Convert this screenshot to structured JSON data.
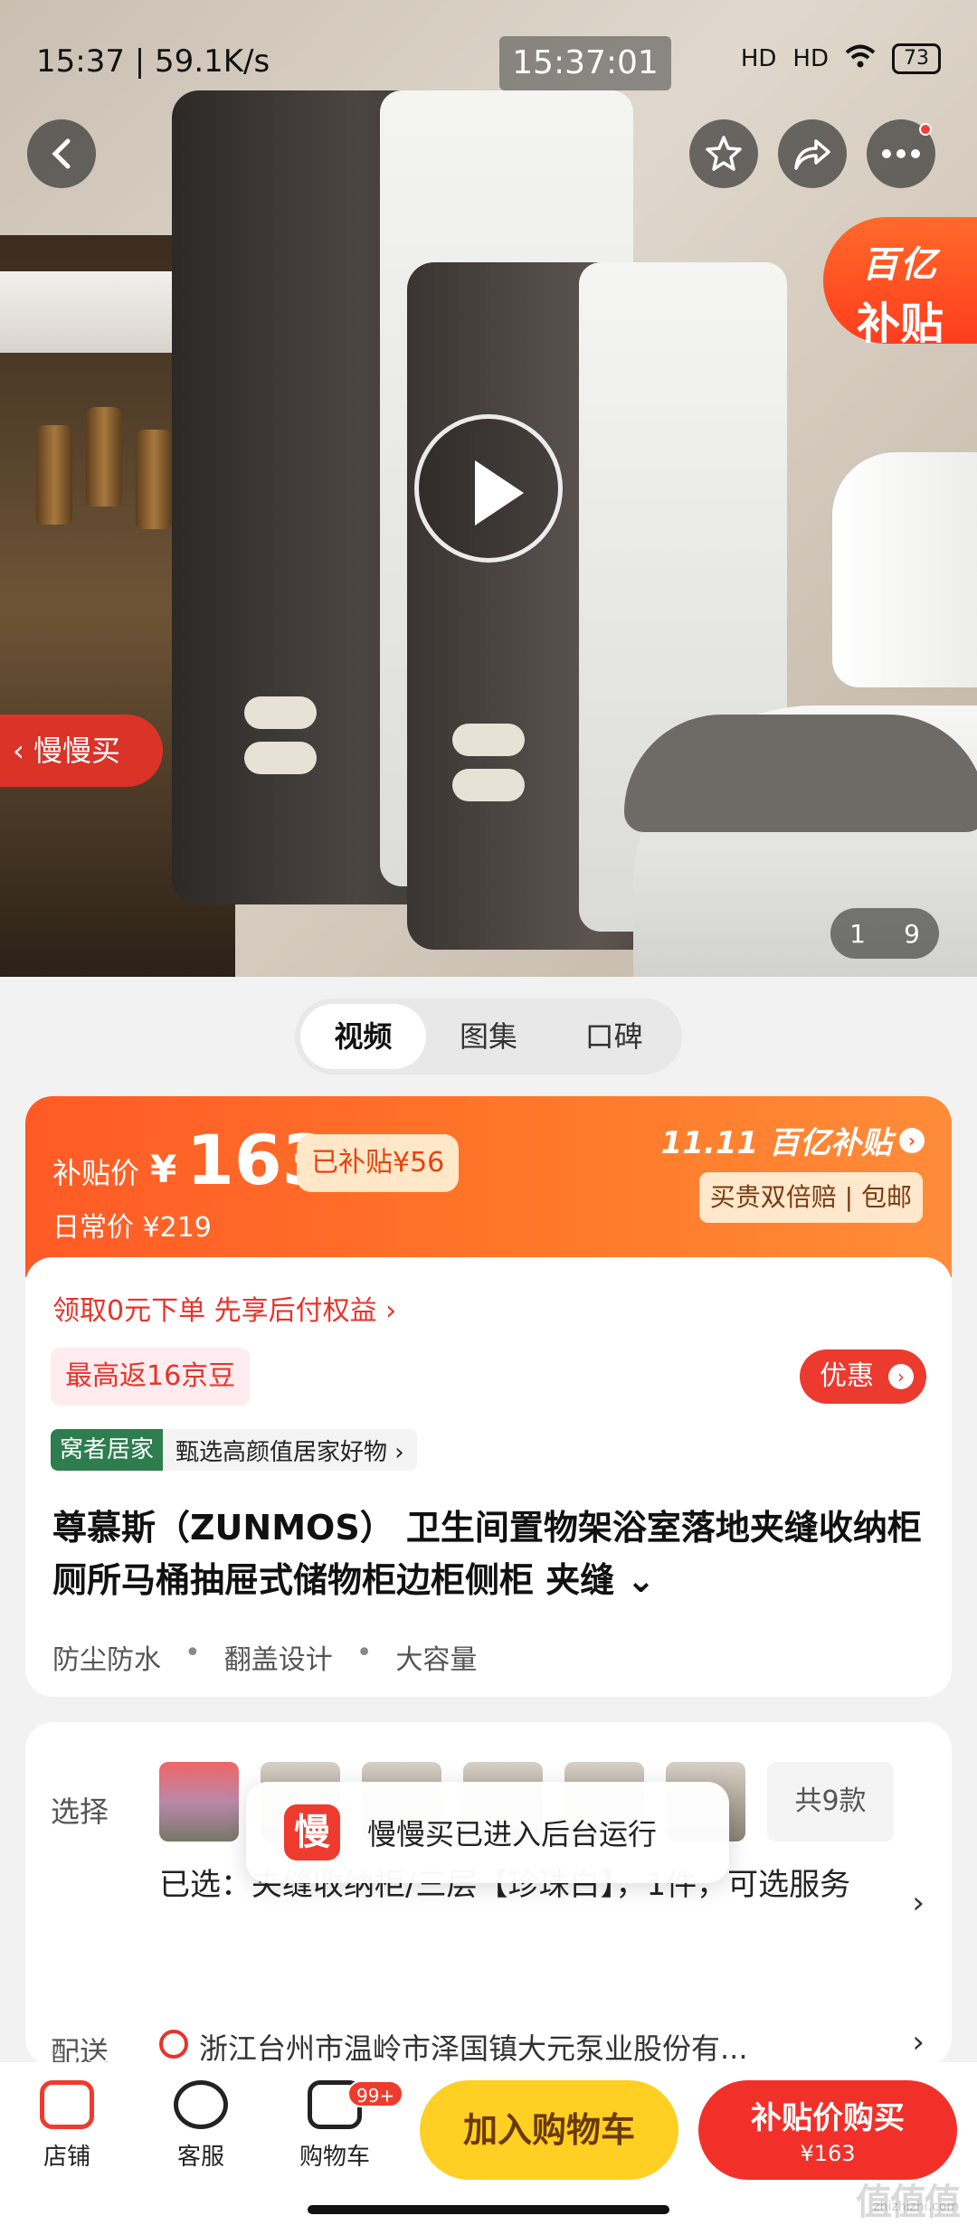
{
  "status_bar": {
    "left_text": "15:37 | 59.1K/s",
    "center_time": "15:37:01",
    "signal_1": "HD",
    "signal_2": "HD",
    "battery": "73"
  },
  "hero": {
    "subsidy_badge_line1": "百亿",
    "subsidy_badge_line2": "补贴",
    "slow_buy_tag": "慢慢买",
    "pager_current": "1",
    "pager_total": "9"
  },
  "media_tabs": [
    "视频",
    "图集",
    "口碑"
  ],
  "price": {
    "label": "补贴价",
    "currency": "¥",
    "value": "163",
    "saved_tag": "已补贴¥56",
    "daily_price": "日常价 ¥219",
    "promo_logo": "11.11 百亿补贴",
    "promo_sub": "买贵双倍赔 | 包邮"
  },
  "product": {
    "pay_later": "领取0元下单 先享后付权益 ›",
    "beans": "最高返16京豆",
    "discount_button": "优惠",
    "brand_badge": "窝者居家",
    "brand_text": "甄选高颜值居家好物 ›",
    "title": "尊慕斯（ZUNMOS） 卫生间置物架浴室落地夹缝收纳柜厕所马桶抽屉式储物柜边柜侧柜 夹缝 ⌄",
    "features": [
      "防尘防水",
      "翻盖设计",
      "大容量"
    ]
  },
  "options": {
    "select_label": "选择",
    "total_variants": "共9款",
    "selected_text": "已选：夹缝收纳柜/三层【珍珠白】，1件，可选服务",
    "shipping_label": "配送",
    "shipping_text": "浙江台州市温岭市泽国镇大元泵业股份有..."
  },
  "toast": {
    "logo_char": "慢",
    "text": "慢慢买已进入后台运行"
  },
  "bottom_nav": {
    "shop": "店铺",
    "service": "客服",
    "cart": "购物车",
    "cart_badge": "99+",
    "add_to_cart": "加入购物车",
    "buy_title": "补贴价购买",
    "buy_price": "¥163"
  },
  "watermark": {
    "logo": "值值值",
    "url": "zhizhizhi.com"
  },
  "colors": {
    "accent_red": "#f2302a",
    "accent_orange": "#ff5a26",
    "cart_yellow": "#ffcf24"
  }
}
